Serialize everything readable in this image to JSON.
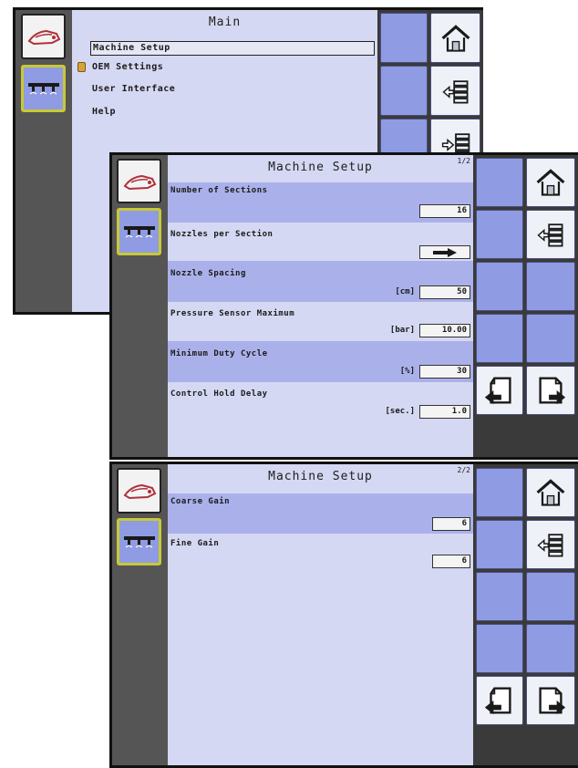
{
  "screen_main": {
    "title": "Main",
    "menu": [
      "Machine Setup",
      "OEM Settings",
      "User Interface",
      "Help"
    ]
  },
  "screen_setup1": {
    "title": "Machine Setup",
    "page": "1/2",
    "settings": [
      {
        "label": "Number of Sections",
        "unit": "",
        "value": "16"
      },
      {
        "label": "Nozzles per Section",
        "unit": "",
        "value": ""
      },
      {
        "label": "Nozzle Spacing",
        "unit": "[cm]",
        "value": "50"
      },
      {
        "label": "Pressure Sensor Maximum",
        "unit": "[bar]",
        "value": "10.00"
      },
      {
        "label": "Minimum Duty Cycle",
        "unit": "[%]",
        "value": "30"
      },
      {
        "label": "Control Hold Delay",
        "unit": "[sec.]",
        "value": "1.0"
      }
    ]
  },
  "screen_setup2": {
    "title": "Machine Setup",
    "page": "2/2",
    "settings": [
      {
        "label": "Coarse Gain",
        "unit": "",
        "value": "6"
      },
      {
        "label": "Fine Gain",
        "unit": "",
        "value": "6"
      }
    ]
  },
  "icons": {
    "sprayer": "sprayer-icon",
    "nozzles": "nozzle-boom-icon",
    "home": "home-icon",
    "menu_back": "menu-back-icon",
    "menu_forward": "menu-forward-icon",
    "page_prev": "page-previous-icon",
    "page_next": "page-next-icon",
    "lock": "lock-icon"
  },
  "colors": {
    "content_bg": "#d5d8f2",
    "highlight_row": "#aab1ea",
    "soft_key": "#8f9be3",
    "selected_border": "#c9c934"
  }
}
